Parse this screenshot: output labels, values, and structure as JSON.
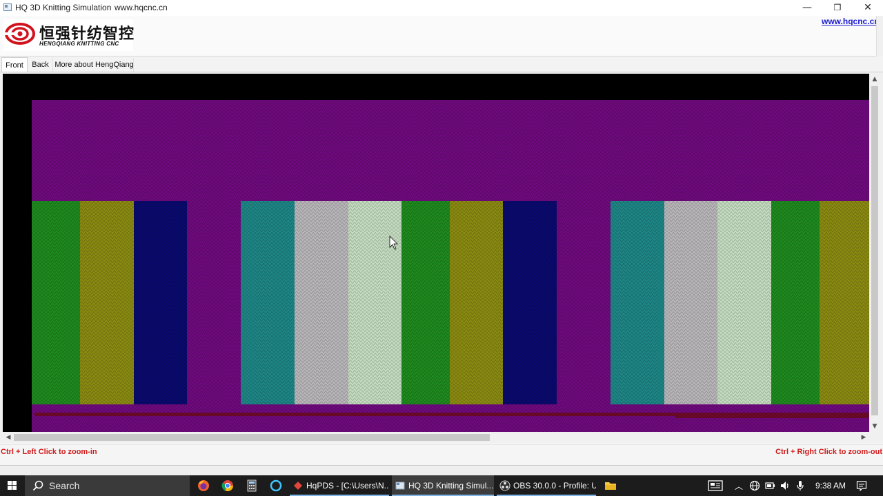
{
  "window": {
    "title": "HQ 3D Knitting Simulation",
    "title_url": "www.hqcnc.cn",
    "controls": {
      "minimize": "—",
      "maximize": "❐",
      "close": "✕"
    }
  },
  "header": {
    "logo_cn": "恒强针纺智控",
    "logo_en": "HENGQIANG KNITTING CNC",
    "link": "www.hqcnc.cn"
  },
  "tabs": [
    {
      "label": "Front",
      "active": true
    },
    {
      "label": "Back",
      "active": false
    },
    {
      "label": "More about HengQiang",
      "active": false
    }
  ],
  "colors": {
    "black": "#000000",
    "purple": "#6f0a7e",
    "green": "#1e8a1e",
    "olive": "#8a8a12",
    "navy": "#0a0a6e",
    "teal": "#1e8686",
    "gray": "#b8b6b8",
    "light_green": "#c4dcc0",
    "maroon": "#6e0a2a",
    "hint_red": "#d01a1a",
    "link_blue": "#1a1ad0"
  },
  "fabric": {
    "stripes": [
      "green",
      "olive",
      "navy",
      "purple",
      "teal",
      "gray",
      "light_green",
      "green",
      "olive",
      "navy",
      "purple",
      "teal",
      "gray",
      "light_green",
      "green",
      "olive"
    ]
  },
  "scrollbars": {
    "up": "▲",
    "down": "▼",
    "left": "◀",
    "right": "▶"
  },
  "hints": {
    "left": "Ctrl + Left Click to zoom-in",
    "right": "Ctrl + Right Click to zoom-out"
  },
  "taskbar": {
    "search": "Search",
    "apps": [
      {
        "label": "HqPDS - [C:\\Users\\N...",
        "icon": "hqpds-icon"
      },
      {
        "label": "HQ 3D Knitting Simul...",
        "icon": "hq3d-icon",
        "active": true
      },
      {
        "label": "OBS 30.0.0 - Profile: U...",
        "icon": "obs-icon"
      }
    ],
    "clock": "9:38 AM"
  }
}
